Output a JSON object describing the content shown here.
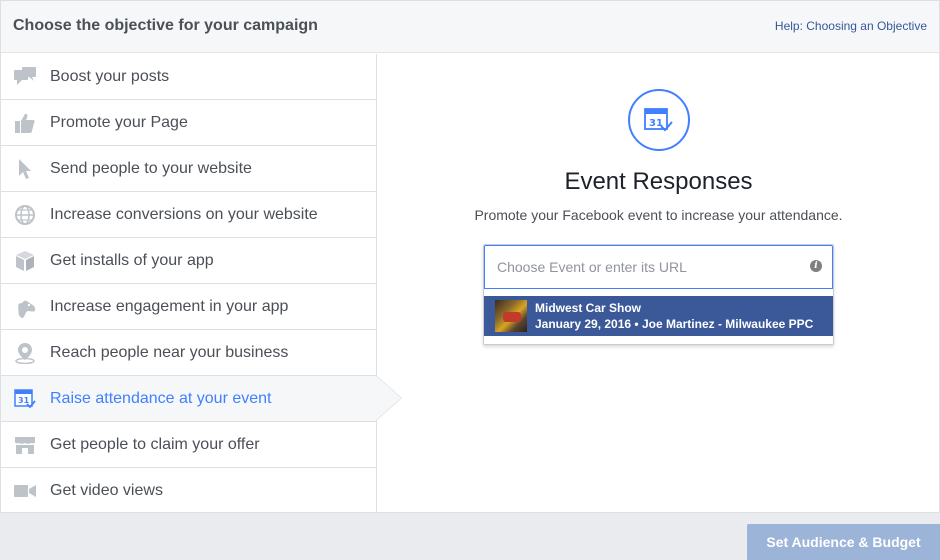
{
  "header": {
    "title": "Choose the objective for your campaign",
    "help_link": "Help: Choosing an Objective"
  },
  "sidebar": {
    "items": [
      {
        "label": "Boost your posts",
        "icon": "speech-bubbles-icon"
      },
      {
        "label": "Promote your Page",
        "icon": "thumbs-up-icon"
      },
      {
        "label": "Send people to your website",
        "icon": "cursor-icon"
      },
      {
        "label": "Increase conversions on your website",
        "icon": "globe-icon"
      },
      {
        "label": "Get installs of your app",
        "icon": "box-icon"
      },
      {
        "label": "Increase engagement in your app",
        "icon": "gamepad-icon"
      },
      {
        "label": "Reach people near your business",
        "icon": "location-pin-icon"
      },
      {
        "label": "Raise attendance at your event",
        "icon": "calendar-icon"
      },
      {
        "label": "Get people to claim your offer",
        "icon": "storefront-icon"
      },
      {
        "label": "Get video views",
        "icon": "video-camera-icon"
      }
    ],
    "active_index": 7
  },
  "main": {
    "title": "Event Responses",
    "subtitle": "Promote your Facebook event to increase your attendance.",
    "calendar_day": "31",
    "input_placeholder": "Choose Event or enter its URL",
    "info_glyph": "i",
    "event": {
      "name": "Midwest Car Show",
      "meta": "January 29, 2016 • Joe Martinez - Milwaukee PPC"
    }
  },
  "footer": {
    "button_label": "Set Audience & Budget"
  },
  "colors": {
    "accent": "#4080ff",
    "event_row_bg": "#3b5999",
    "icon_gray": "#bec3c9",
    "button_disabled": "#9cb4d8"
  }
}
